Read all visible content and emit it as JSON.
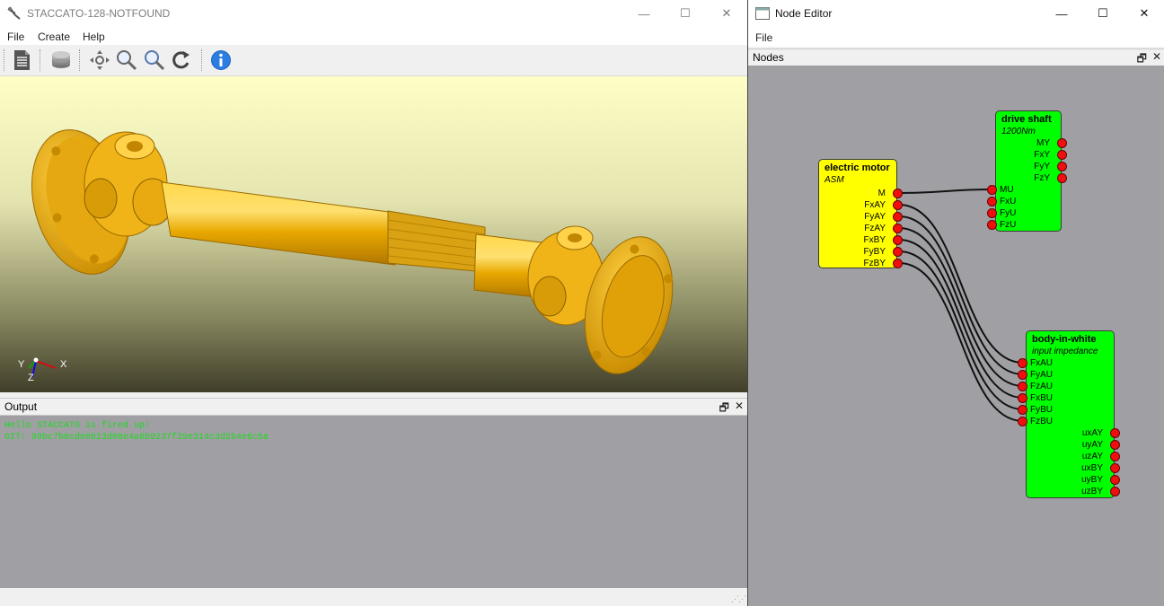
{
  "main_window": {
    "title": "STACCATO-128-NOTFOUND",
    "window_buttons": {
      "minimize": "—",
      "maximize": "☐",
      "close": "✕"
    },
    "menu": [
      "File",
      "Create",
      "Help"
    ],
    "toolbar_icons": [
      "document-icon",
      "layers-icon",
      "pan-icon",
      "zoom-in-icon",
      "zoom-out-icon",
      "rotate-icon",
      "info-icon"
    ],
    "axis_labels": {
      "x": "X",
      "y": "Y",
      "z": "Z"
    },
    "output_panel": {
      "title": "Output",
      "float_glyph": "🗗",
      "close_glyph": "✕",
      "lines": [
        "Hello STACCATO is fired up!",
        "GIT: 99bc7b8cde0b23d08e4a6b9237f29e314c3d2b4e6c5a"
      ]
    }
  },
  "node_editor": {
    "title": "Node Editor",
    "window_buttons": {
      "minimize": "—",
      "maximize": "☐",
      "close": "✕"
    },
    "menu": [
      "File"
    ],
    "panel_title": "Nodes",
    "panel_icons": {
      "float": "🗗",
      "close": "✕"
    },
    "nodes": [
      {
        "title": "electric motor",
        "subtitle": "ASM",
        "color": "#ffff00",
        "outputs": [
          "M",
          "FxAY",
          "FyAY",
          "FzAY",
          "FxBY",
          "FyBY",
          "FzBY"
        ],
        "inputs": []
      },
      {
        "title": "drive shaft",
        "subtitle": "1200Nm",
        "color": "#00ff00",
        "outputs": [
          "MY",
          "FxY",
          "FyY",
          "FzY"
        ],
        "inputs": [
          "MU",
          "FxU",
          "FyU",
          "FzU"
        ]
      },
      {
        "title": "body-in-white",
        "subtitle": "input impedance",
        "color": "#00ff00",
        "inputs": [
          "FxAU",
          "FyAU",
          "FzAU",
          "FxBU",
          "FyBU",
          "FzBU"
        ],
        "outputs": [
          "uxAY",
          "uyAY",
          "uzAY",
          "uxBY",
          "uyBY",
          "uzBY"
        ]
      }
    ],
    "connections": [
      {
        "from": "electric motor.M",
        "to": "drive shaft.MU"
      },
      {
        "from": "electric motor.FxAY",
        "to": "body-in-white.FxAU"
      },
      {
        "from": "electric motor.FyAY",
        "to": "body-in-white.FyAU"
      },
      {
        "from": "electric motor.FzAY",
        "to": "body-in-white.FzAU"
      },
      {
        "from": "electric motor.FxBY",
        "to": "body-in-white.FxBU"
      },
      {
        "from": "electric motor.FyBY",
        "to": "body-in-white.FyBU"
      },
      {
        "from": "electric motor.FzBY",
        "to": "body-in-white.FzBU"
      }
    ]
  },
  "colors": {
    "shaft": "#f2b617",
    "port": "#ee1010",
    "output_text": "#1fd81f"
  }
}
